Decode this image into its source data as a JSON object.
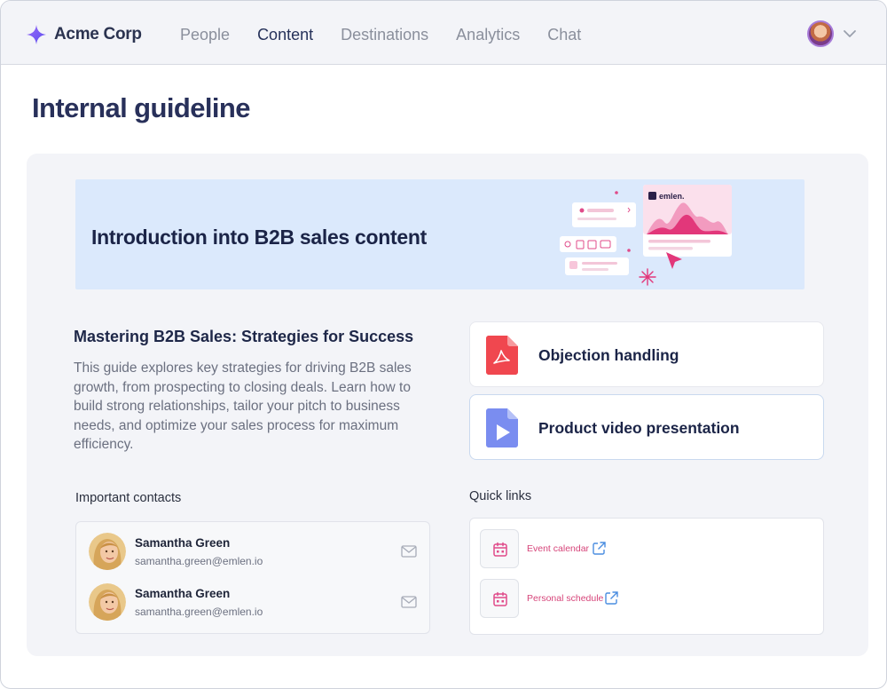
{
  "app": {
    "brand_name": "Acme Corp",
    "accent": "#7b5cf5"
  },
  "nav": {
    "items": [
      {
        "label": "People",
        "active": false
      },
      {
        "label": "Content",
        "active": true
      },
      {
        "label": "Destinations",
        "active": false
      },
      {
        "label": "Analytics",
        "active": false
      },
      {
        "label": "Chat",
        "active": false
      }
    ]
  },
  "page": {
    "title": "Internal guideline"
  },
  "banner": {
    "title": "Introduction into B2B sales content",
    "art_brand": "emlen."
  },
  "article": {
    "title": "Mastering B2B Sales: Strategies for Success",
    "body": "This guide explores key strategies for driving B2B sales growth, from prospecting to closing deals. Learn how to build strong relationships, tailor your pitch to business needs, and optimize your sales process for maximum efficiency."
  },
  "files": [
    {
      "label": "Objection handling",
      "icon": "pdf-file-icon",
      "color": "#f0474f"
    },
    {
      "label": "Product video presentation",
      "icon": "video-file-icon",
      "color": "#7a8df0"
    }
  ],
  "contacts": {
    "label": "Important contacts",
    "items": [
      {
        "name": "Samantha Green",
        "email": "samantha.green@emlen.io"
      },
      {
        "name": "Samantha Green",
        "email": "samantha.green@emlen.io"
      }
    ]
  },
  "quick_links": {
    "label": "Quick links",
    "items": [
      {
        "label": "Event calendar",
        "icon": "calendar-icon"
      },
      {
        "label": "Personal schedule",
        "icon": "calendar-icon"
      }
    ],
    "link_color": "#d6457a"
  }
}
